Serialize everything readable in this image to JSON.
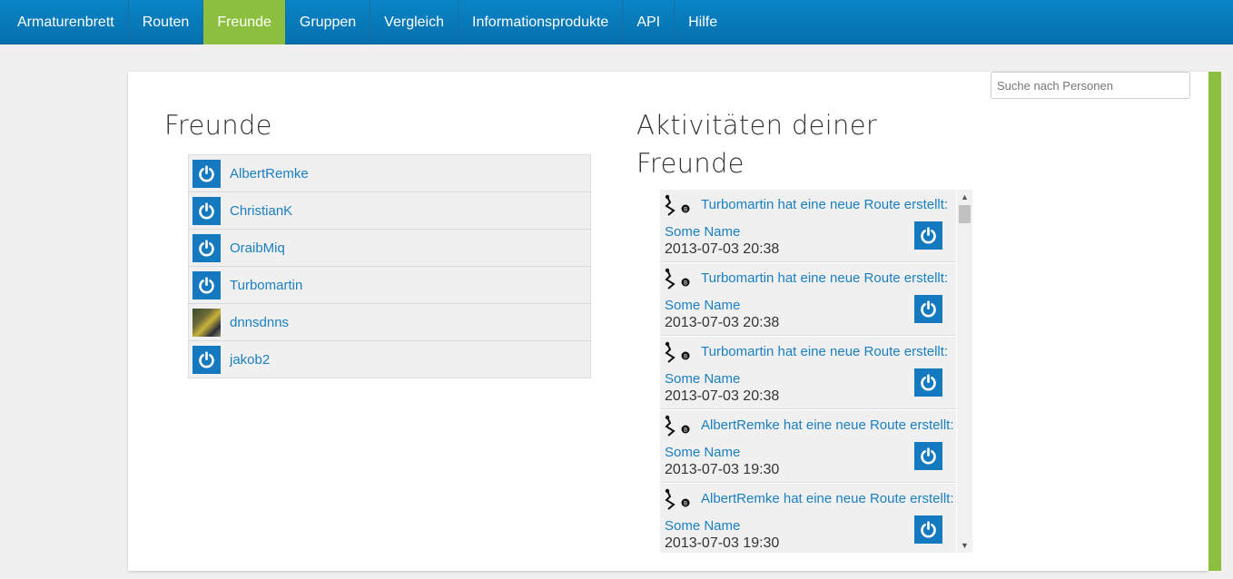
{
  "nav": {
    "items": [
      {
        "label": "Armaturenbrett"
      },
      {
        "label": "Routen"
      },
      {
        "label": "Freunde"
      },
      {
        "label": "Gruppen"
      },
      {
        "label": "Vergleich"
      },
      {
        "label": "Informationsprodukte"
      },
      {
        "label": "API"
      },
      {
        "label": "Hilfe"
      }
    ],
    "active": "Freunde"
  },
  "search": {
    "placeholder": "Suche nach Personen"
  },
  "friends": {
    "title": "Freunde",
    "list": [
      {
        "name": "AlbertRemke",
        "avatar": "power-icon"
      },
      {
        "name": "ChristianK",
        "avatar": "power-icon"
      },
      {
        "name": "OraibMiq",
        "avatar": "power-icon"
      },
      {
        "name": "Turbomartin",
        "avatar": "power-icon"
      },
      {
        "name": "dnnsdnns",
        "avatar": "photo"
      },
      {
        "name": "jakob2",
        "avatar": "power-icon"
      }
    ]
  },
  "activity": {
    "title": "Aktivitäten deiner Freunde",
    "items": [
      {
        "text": "Turbomartin hat eine neue Route erstellt:",
        "name": "Some Name",
        "date": "2013-07-03 20:38"
      },
      {
        "text": "Turbomartin hat eine neue Route erstellt:",
        "name": "Some Name",
        "date": "2013-07-03 20:38"
      },
      {
        "text": "Turbomartin hat eine neue Route erstellt:",
        "name": "Some Name",
        "date": "2013-07-03 20:38"
      },
      {
        "text": "AlbertRemke hat eine neue Route erstellt:",
        "name": "Some Name",
        "date": "2013-07-03 19:30"
      },
      {
        "text": "AlbertRemke hat eine neue Route erstellt:",
        "name": "Some Name",
        "date": "2013-07-03 19:30"
      }
    ]
  },
  "colors": {
    "nav_bg": "#0a84c6",
    "active": "#8cbf3f",
    "link": "#1a7fc1",
    "avatar_bg": "#1479bf"
  }
}
